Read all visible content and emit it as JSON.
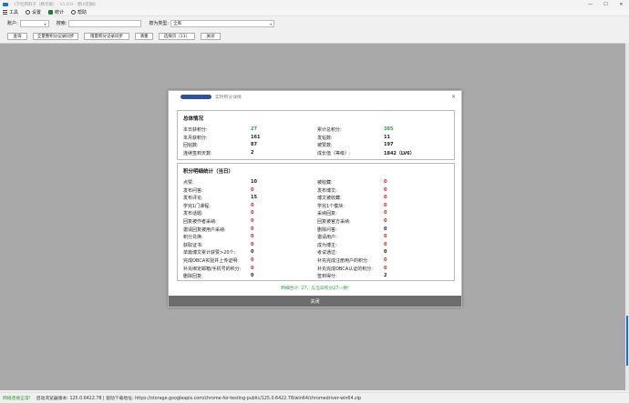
{
  "window": {
    "title": "《学社爬取子（精华版）- V1.0.0 - 使UI走酬》",
    "controls": {
      "minimize": "—",
      "maximize": "☐",
      "close": "✕"
    }
  },
  "menu": {
    "items": [
      {
        "icon": "list-icon",
        "label": "工具"
      },
      {
        "icon": "gear-icon",
        "label": "设置"
      },
      {
        "icon": "excel-icon",
        "label": "统计"
      },
      {
        "icon": "help-icon",
        "label": "帮助"
      }
    ]
  },
  "filters": {
    "account_label": "账户:",
    "account_value": "",
    "search_label": "搜索:",
    "search_value": "",
    "sort_label": "按为类型:",
    "sort_value": "全库"
  },
  "buttons": {
    "query": "查询",
    "export_all": "全量整积分记录同步",
    "export_sel": "增量积分记录同步",
    "reset": "清重",
    "toggle": "选择页（11）",
    "close": "关闭"
  },
  "dialog": {
    "title": "实时积分详情",
    "close_icon": "✕",
    "overview": {
      "title": "总体情况",
      "left": [
        {
          "label": "本日获积分:",
          "value": "27",
          "color": "green"
        },
        {
          "label": "本月获积分:",
          "value": "161"
        },
        {
          "label": "回帖数:",
          "value": "87"
        },
        {
          "label": "连续签到天数:",
          "value": "2"
        }
      ],
      "right": [
        {
          "label": "累计总积分:",
          "value": "385",
          "color": "green"
        },
        {
          "label": "发帖数:",
          "value": "11"
        },
        {
          "label": "被赞数:",
          "value": "197"
        },
        {
          "label": "成长值（等级）:",
          "value": "1842（LV6）"
        }
      ]
    },
    "detail": {
      "title": "积分明细统计（当日）",
      "left": [
        {
          "label": "点赞:",
          "value": "10",
          "color": "black"
        },
        {
          "label": "发布问答:",
          "value": "0",
          "color": "red"
        },
        {
          "label": "发布评论:",
          "value": "15",
          "color": "black"
        },
        {
          "label": "学完1门课程:",
          "value": "0",
          "color": "red"
        },
        {
          "label": "发布话题:",
          "value": "0",
          "color": "red"
        },
        {
          "label": "回复被作者采纳:",
          "value": "0",
          "color": "red"
        },
        {
          "label": "邀请回复被用户采纳:",
          "value": "0",
          "color": "red"
        },
        {
          "label": "积分兑换:",
          "value": "0",
          "color": "red"
        },
        {
          "label": "获取证书:",
          "value": "0",
          "color": "red"
        },
        {
          "label": "单篇博文累计获赞>20个:",
          "value": "0",
          "color": "black"
        },
        {
          "label": "完成OBCA实验并上传证明:",
          "value": "0",
          "color": "red"
        },
        {
          "label": "补充绑定邮箱/手机号的积分:",
          "value": "0",
          "color": "red"
        },
        {
          "label": "删除回复:",
          "value": "0",
          "color": "black"
        }
      ],
      "right": [
        {
          "label": "被收藏:",
          "value": "0",
          "color": "red"
        },
        {
          "label": "发布博文:",
          "value": "0",
          "color": "red"
        },
        {
          "label": "博文被收藏:",
          "value": "0",
          "color": "red"
        },
        {
          "label": "学完1个模块:",
          "value": "0",
          "color": "red"
        },
        {
          "label": "采纳回复:",
          "value": "0",
          "color": "red"
        },
        {
          "label": "回复被官方采纳:",
          "value": "0",
          "color": "red"
        },
        {
          "label": "删除问答:",
          "value": "0",
          "color": "black"
        },
        {
          "label": "邀请用户:",
          "value": "0",
          "color": "red"
        },
        {
          "label": "成为博主:",
          "value": "0",
          "color": "red"
        },
        {
          "label": "考试通过:",
          "value": "0",
          "color": "black"
        },
        {
          "label": "补充完成注册用户的积分:",
          "value": "0",
          "color": "red"
        },
        {
          "label": "补充完成OBCA认证的积分:",
          "value": "0",
          "color": "red"
        },
        {
          "label": "签到得分:",
          "value": "2",
          "color": "black"
        }
      ]
    },
    "footer": "明细合计: 27，与当日积分27一致!",
    "close_button": "关闭"
  },
  "status": {
    "ok_text": "网络连接正常!",
    "text": "启动浏览器版本: 125.0.6422.78 | 驱动下载地址: https://storage.googleapis.com/chrome-for-testing-public/125.0.6422.78/win64/chromedriver-win64.zip"
  },
  "colors": {
    "green": "#2f9e3a",
    "red": "#e02020",
    "scroll_accent": "#1e6fd9",
    "content_bg": "#a9a9a9"
  }
}
